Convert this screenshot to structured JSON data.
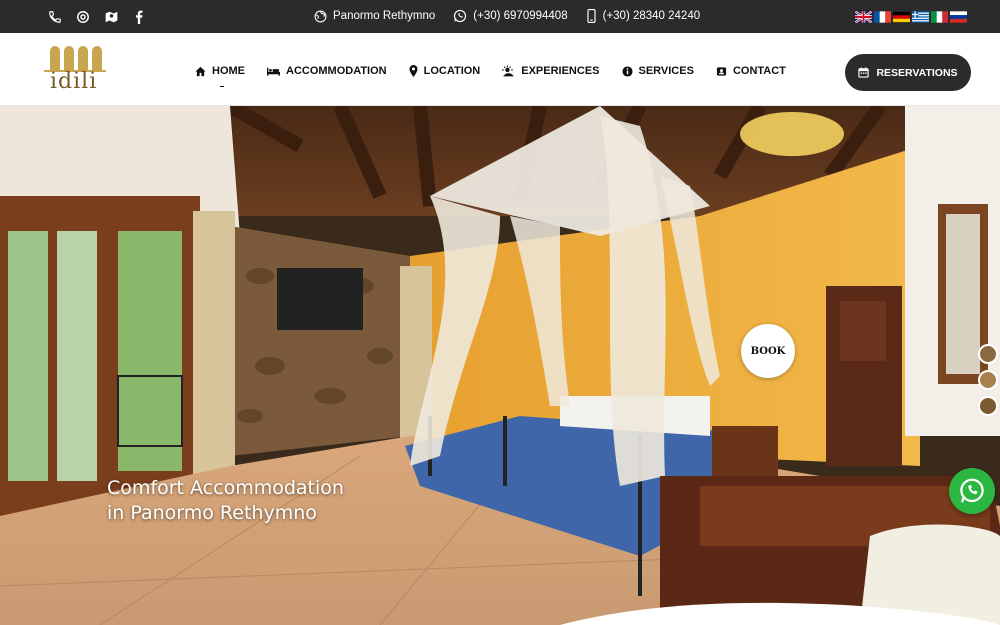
{
  "topbar": {
    "icons": [
      "phone-icon",
      "email-icon",
      "map-icon",
      "facebook-icon"
    ],
    "location": "Panormo Rethymno",
    "whatsapp": "(+30) 6970994408",
    "phone": "(+30) 28340 24240",
    "languages": [
      "English",
      "French",
      "German",
      "Greek",
      "Italian",
      "Russian"
    ]
  },
  "header": {
    "logo_text": "idili",
    "nav": [
      {
        "label": "HOME",
        "icon": "home-icon"
      },
      {
        "label": "ACCOMMODATION",
        "icon": "bed-icon"
      },
      {
        "label": "LOCATION",
        "icon": "pin-icon"
      },
      {
        "label": "EXPERIENCES",
        "icon": "sun-icon"
      },
      {
        "label": "SERVICES",
        "icon": "info-icon"
      },
      {
        "label": "CONTACT",
        "icon": "contact-icon"
      }
    ],
    "reservations_label": "RESERVATIONS"
  },
  "hero": {
    "line1": "Comfort Accommodation",
    "line2": "in Panormo Rethymno",
    "book_label": "BOOK"
  },
  "colors": {
    "dark": "#2b2b2b",
    "whatsapp": "#2bb741",
    "logo": "#c8a650"
  }
}
